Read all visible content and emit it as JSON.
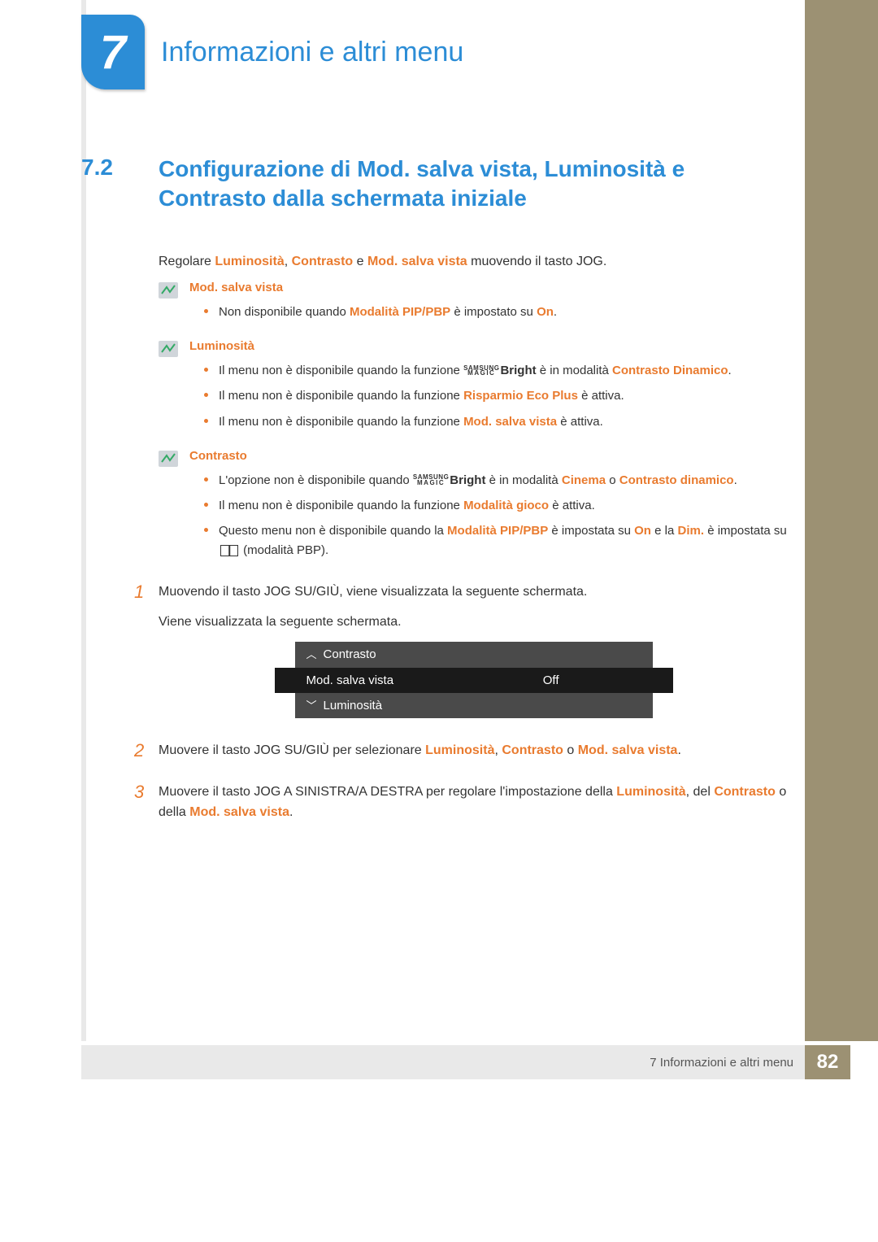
{
  "chapter": {
    "number": "7",
    "title": "Informazioni e altri menu"
  },
  "section": {
    "number": "7.2",
    "title": "Configurazione di Mod. salva vista, Luminosità e Contrasto dalla schermata iniziale"
  },
  "intro": {
    "pre": "Regolare ",
    "t1": "Luminosità",
    "sep1": ", ",
    "t2": "Contrasto",
    "sep2": " e ",
    "t3": "Mod. salva vista",
    "post": " muovendo il tasto JOG."
  },
  "notes": [
    {
      "title": "Mod. salva vista",
      "items": [
        {
          "pre": "Non disponibile quando ",
          "t1": "Modalità PIP/PBP",
          "mid": " è impostato su ",
          "t2": "On",
          "post": "."
        }
      ]
    },
    {
      "title": "Luminosità",
      "items": [
        {
          "pre": "Il menu non è disponibile quando la funzione ",
          "magic": true,
          "mid": " è in modalità ",
          "t2": "Contrasto Dinamico",
          "post": "."
        },
        {
          "pre": "Il menu non è disponibile quando la funzione ",
          "t1": "Risparmio Eco Plus",
          "post": " è attiva."
        },
        {
          "pre": "Il menu non è disponibile quando la funzione ",
          "t1": "Mod. salva vista",
          "post": " è attiva."
        }
      ]
    },
    {
      "title": "Contrasto",
      "items": [
        {
          "pre": "L'opzione non è disponibile quando ",
          "magic": true,
          "mid": " è in modalità ",
          "t2": "Cinema",
          "sep": " o ",
          "t3": "Contrasto dinamico",
          "post": "."
        },
        {
          "pre": "Il menu non è disponibile quando la funzione ",
          "t1": "Modalità gioco",
          "post": " è attiva."
        },
        {
          "pre": "Questo menu non è disponibile quando la ",
          "t1": "Modalità PIP/PBP",
          "mid": " è impostata su ",
          "t2": "On",
          "mid2": " e la ",
          "t3": "Dim.",
          "mid3": " è impostata su ",
          "pbp": true,
          "post": " (modalità PBP)."
        }
      ]
    }
  ],
  "magic": {
    "top": "SAMSUNG",
    "bottom": "MAGIC",
    "right": "Bright"
  },
  "steps": {
    "s1": {
      "num": "1",
      "line1": "Muovendo il tasto JOG SU/GIÙ, viene visualizzata la seguente schermata.",
      "line2": "Viene visualizzata la seguente schermata."
    },
    "s2": {
      "num": "2",
      "pre": "Muovere il tasto JOG SU/GIÙ per selezionare ",
      "t1": "Luminosità",
      "sep1": ", ",
      "t2": "Contrasto",
      "sep2": " o ",
      "t3": "Mod. salva vista",
      "post": "."
    },
    "s3": {
      "num": "3",
      "pre": "Muovere il tasto JOG A SINISTRA/A DESTRA per regolare l'impostazione della ",
      "t1": "Luminosità",
      "mid": ", del ",
      "t2": "Contrasto",
      "mid2": " o della ",
      "t3": "Mod. salva vista",
      "post": "."
    }
  },
  "osd": {
    "up": "Contrasto",
    "mid_label": "Mod. salva vista",
    "mid_value": "Off",
    "down": "Luminosità"
  },
  "footer": {
    "text": "7 Informazioni e altri menu",
    "page": "82"
  }
}
